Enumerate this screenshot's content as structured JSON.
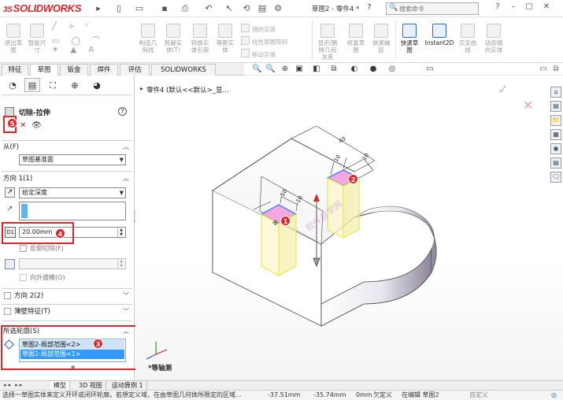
{
  "titlebar": {
    "logo_ds": "3S",
    "logo_text": "SOLIDWORKS",
    "doc_title": "草图2 - 零件4 *",
    "search_placeholder": "搜索命令",
    "win_min": "–",
    "win_max": "□",
    "win_close": "✕"
  },
  "ribbon": {
    "large": [
      {
        "label": "退出草\n图"
      },
      {
        "label": "智能尺\n寸"
      },
      {
        "label": "构造几\n何线"
      },
      {
        "label": "剪裁实\n体(T)"
      },
      {
        "label": "转换实\n体引用"
      },
      {
        "label": "等距实\n体"
      },
      {
        "label": "显示/删\n除几何\n关系"
      },
      {
        "label": "修复草\n图"
      },
      {
        "label": "快速捕\n捉"
      },
      {
        "label": "快速草\n图"
      },
      {
        "label": "Instant2D"
      },
      {
        "label": "交叉曲\n线"
      },
      {
        "label": "动态镜\n向实体"
      }
    ],
    "small": [
      {
        "label": "镜向实体"
      },
      {
        "label": "线性草图阵列"
      },
      {
        "label": "移动实体"
      }
    ]
  },
  "tabs": [
    "特征",
    "草图",
    "钣金",
    "焊件",
    "评估",
    "SOLIDWORKS MBD"
  ],
  "panel": {
    "feature_title": "切除-拉伸",
    "help_icon": "?",
    "ok_symbol": "✓",
    "cancel_symbol": "✕",
    "from_label": "从(F)",
    "from_value": "草图基准面",
    "dir1_label": "方向 1(1)",
    "end_condition": "给定深度",
    "depth_value": "20.00mm",
    "flip_label": "反侧切除(F)",
    "draft_outward_label": "向外拔模(O)",
    "dir2_label": "方向 2(2)",
    "thin_label": "薄壁特征(T)",
    "contours_label": "所选轮廓(S)",
    "contours": [
      "草图2-局部范围<2>",
      "草图2-局部范围<1>"
    ]
  },
  "badges": [
    "1",
    "2",
    "3",
    "4",
    "5"
  ],
  "viewport": {
    "breadcrumb": "零件4 (默认<<默认>_显...",
    "view_label": "*等轴测",
    "dims": [
      "10",
      "10",
      "10",
      "10",
      "40"
    ],
    "watermark": "软件自学网"
  },
  "view_toolbar_icons": [
    "🔍",
    "🔍",
    "⊕",
    "▣",
    "◧",
    "⧉",
    "◐",
    "●",
    "◎",
    "▭"
  ],
  "taskpane_icons": [
    "⌂",
    "▤",
    "📁",
    "▦",
    "◉",
    "▤",
    "🗨"
  ],
  "bottom_tabs": [
    "模型",
    "3D 视图",
    "运动算例 1"
  ],
  "status": {
    "message": "选择一草图实体来定义开环或闭环轮廓。若想定义域，在由草图几何体所限定的区域...",
    "x": "-37.51mm",
    "y": "-35.74mm",
    "z": "0mm",
    "state": "欠定义",
    "editing": "在编辑 草图2",
    "units": "自定义"
  }
}
